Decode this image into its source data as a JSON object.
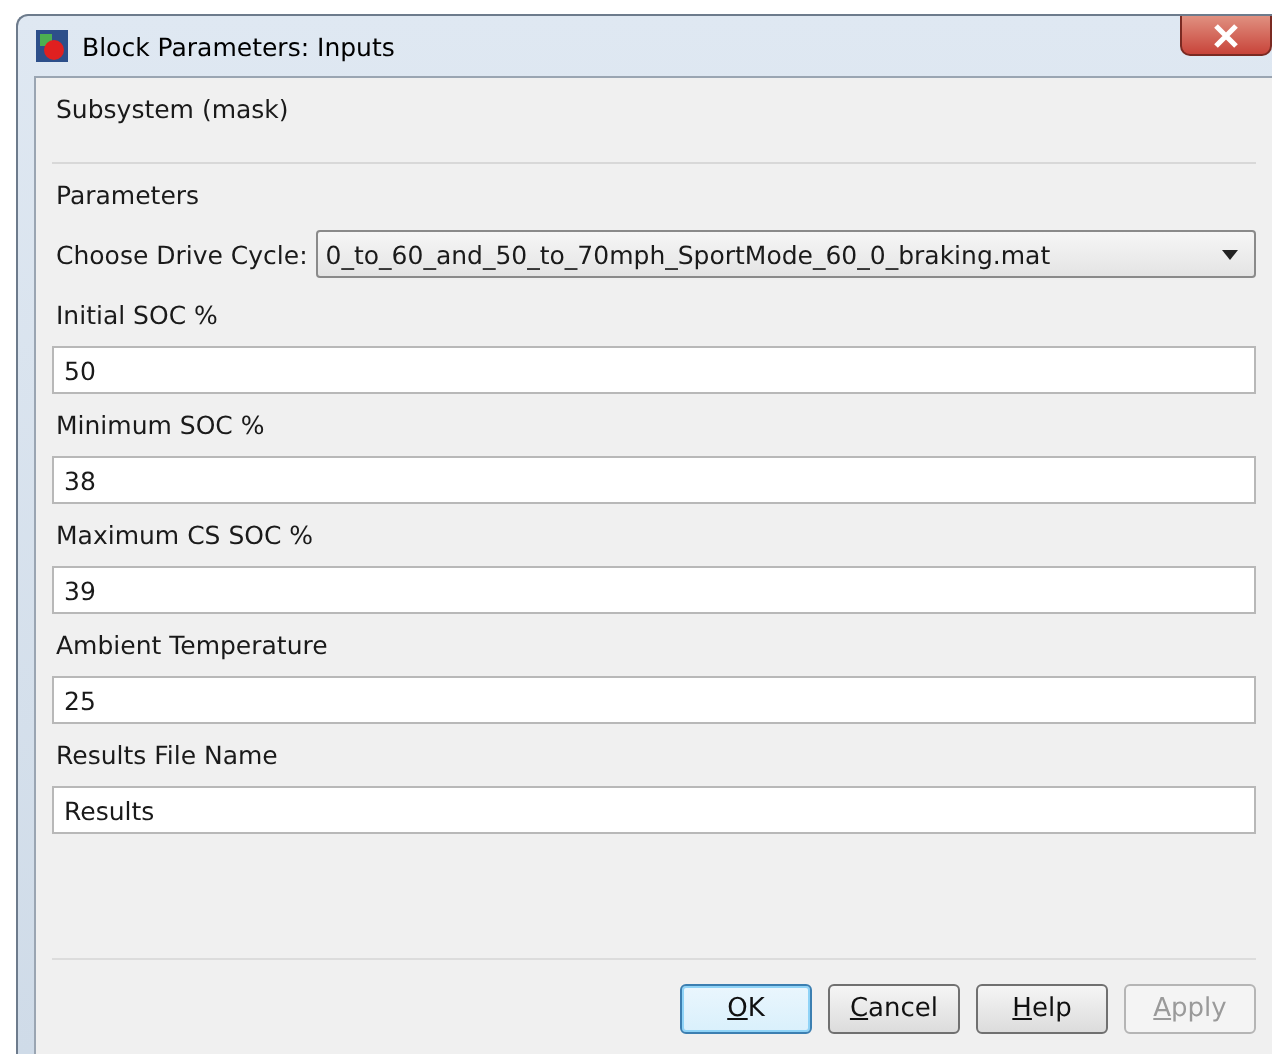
{
  "window": {
    "title": "Block Parameters: Inputs"
  },
  "mask_title": "Subsystem (mask)",
  "group_title": "Parameters",
  "dropdown": {
    "label": "Choose Drive Cycle:",
    "value": "0_to_60_and_50_to_70mph_SportMode_60_0_braking.mat"
  },
  "fields": [
    {
      "label": "Initial SOC %",
      "value": "50"
    },
    {
      "label": "Minimum SOC %",
      "value": "38"
    },
    {
      "label": "Maximum CS SOC %",
      "value": "39"
    },
    {
      "label": "Ambient Temperature",
      "value": "25"
    },
    {
      "label": "Results File Name",
      "value": "Results"
    }
  ],
  "buttons": [
    {
      "label": "OK",
      "default": true,
      "disabled": false,
      "underline_first": true
    },
    {
      "label": "Cancel",
      "default": false,
      "disabled": false,
      "underline_first": true
    },
    {
      "label": "Help",
      "default": false,
      "disabled": false,
      "underline_first": true
    },
    {
      "label": "Apply",
      "default": false,
      "disabled": true,
      "underline_first": true
    }
  ]
}
